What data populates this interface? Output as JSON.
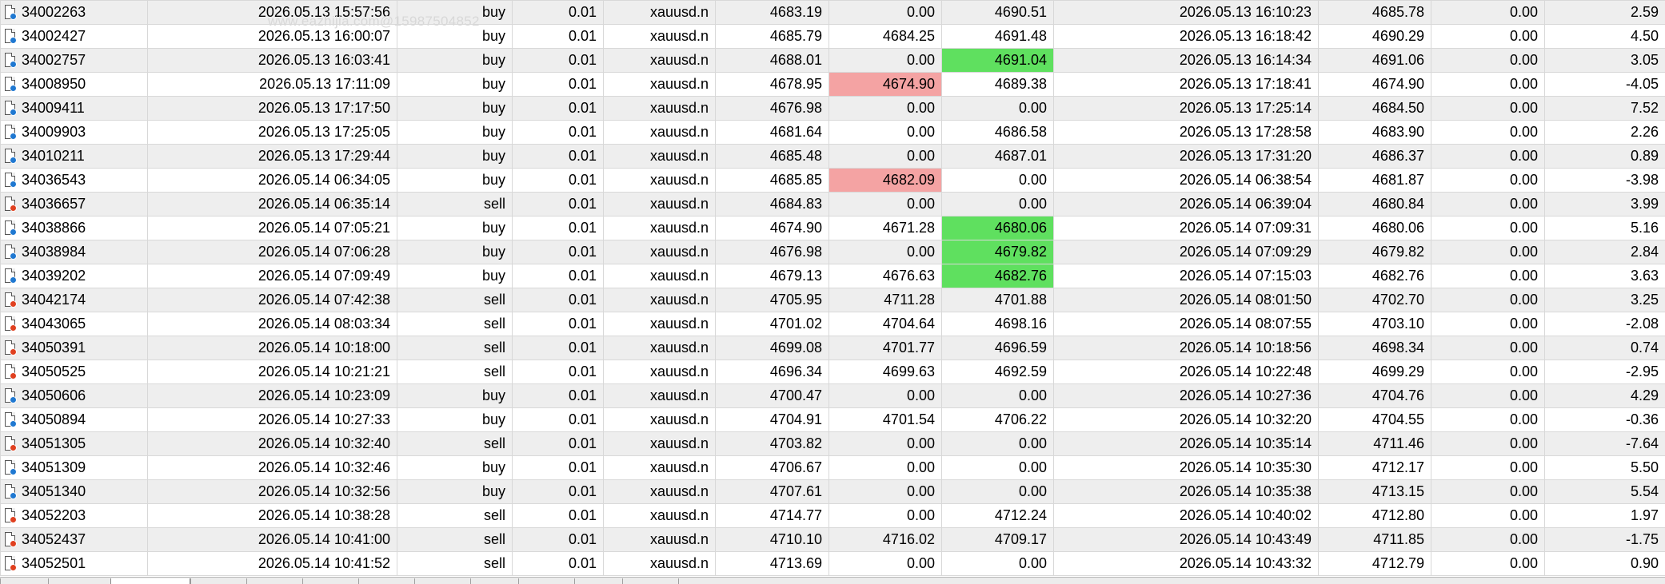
{
  "watermark": "www.eazhijia.com@15987504852",
  "colors": {
    "row_odd": "#eeeeee",
    "row_even": "#ffffff",
    "grid_line": "#d8d8d8",
    "stop_loss_hit": "#f4a3a3",
    "take_profit_hit": "#5fe05f",
    "buy_icon": "#1f78d1",
    "sell_icon": "#e0401f"
  },
  "rows": [
    {
      "ticket": "34002263",
      "open_time": "2026.05.13 15:57:56",
      "type": "buy",
      "volume": "0.01",
      "symbol": "xauusd.n",
      "open_price": "4683.19",
      "sl": "0.00",
      "tp": "4690.51",
      "close_time": "2026.05.13 16:10:23",
      "close_price": "4685.78",
      "swap": "0.00",
      "profit": "2.59",
      "icon": "buy-order-icon",
      "sl_hl": false,
      "tp_hl": false
    },
    {
      "ticket": "34002427",
      "open_time": "2026.05.13 16:00:07",
      "type": "buy",
      "volume": "0.01",
      "symbol": "xauusd.n",
      "open_price": "4685.79",
      "sl": "4684.25",
      "tp": "4691.48",
      "close_time": "2026.05.13 16:18:42",
      "close_price": "4690.29",
      "swap": "0.00",
      "profit": "4.50",
      "icon": "buy-order-icon",
      "sl_hl": false,
      "tp_hl": false
    },
    {
      "ticket": "34002757",
      "open_time": "2026.05.13 16:03:41",
      "type": "buy",
      "volume": "0.01",
      "symbol": "xauusd.n",
      "open_price": "4688.01",
      "sl": "0.00",
      "tp": "4691.04",
      "close_time": "2026.05.13 16:14:34",
      "close_price": "4691.06",
      "swap": "0.00",
      "profit": "3.05",
      "icon": "buy-order-icon",
      "sl_hl": false,
      "tp_hl": true
    },
    {
      "ticket": "34008950",
      "open_time": "2026.05.13 17:11:09",
      "type": "buy",
      "volume": "0.01",
      "symbol": "xauusd.n",
      "open_price": "4678.95",
      "sl": "4674.90",
      "tp": "4689.38",
      "close_time": "2026.05.13 17:18:41",
      "close_price": "4674.90",
      "swap": "0.00",
      "profit": "-4.05",
      "icon": "buy-order-icon",
      "sl_hl": true,
      "tp_hl": false
    },
    {
      "ticket": "34009411",
      "open_time": "2026.05.13 17:17:50",
      "type": "buy",
      "volume": "0.01",
      "symbol": "xauusd.n",
      "open_price": "4676.98",
      "sl": "0.00",
      "tp": "0.00",
      "close_time": "2026.05.13 17:25:14",
      "close_price": "4684.50",
      "swap": "0.00",
      "profit": "7.52",
      "icon": "buy-order-icon",
      "sl_hl": false,
      "tp_hl": false
    },
    {
      "ticket": "34009903",
      "open_time": "2026.05.13 17:25:05",
      "type": "buy",
      "volume": "0.01",
      "symbol": "xauusd.n",
      "open_price": "4681.64",
      "sl": "0.00",
      "tp": "4686.58",
      "close_time": "2026.05.13 17:28:58",
      "close_price": "4683.90",
      "swap": "0.00",
      "profit": "2.26",
      "icon": "buy-order-icon",
      "sl_hl": false,
      "tp_hl": false
    },
    {
      "ticket": "34010211",
      "open_time": "2026.05.13 17:29:44",
      "type": "buy",
      "volume": "0.01",
      "symbol": "xauusd.n",
      "open_price": "4685.48",
      "sl": "0.00",
      "tp": "4687.01",
      "close_time": "2026.05.13 17:31:20",
      "close_price": "4686.37",
      "swap": "0.00",
      "profit": "0.89",
      "icon": "buy-order-icon",
      "sl_hl": false,
      "tp_hl": false
    },
    {
      "ticket": "34036543",
      "open_time": "2026.05.14 06:34:05",
      "type": "buy",
      "volume": "0.01",
      "symbol": "xauusd.n",
      "open_price": "4685.85",
      "sl": "4682.09",
      "tp": "0.00",
      "close_time": "2026.05.14 06:38:54",
      "close_price": "4681.87",
      "swap": "0.00",
      "profit": "-3.98",
      "icon": "buy-order-icon",
      "sl_hl": true,
      "tp_hl": false
    },
    {
      "ticket": "34036657",
      "open_time": "2026.05.14 06:35:14",
      "type": "sell",
      "volume": "0.01",
      "symbol": "xauusd.n",
      "open_price": "4684.83",
      "sl": "0.00",
      "tp": "0.00",
      "close_time": "2026.05.14 06:39:04",
      "close_price": "4680.84",
      "swap": "0.00",
      "profit": "3.99",
      "icon": "sell-order-icon",
      "sl_hl": false,
      "tp_hl": false
    },
    {
      "ticket": "34038866",
      "open_time": "2026.05.14 07:05:21",
      "type": "buy",
      "volume": "0.01",
      "symbol": "xauusd.n",
      "open_price": "4674.90",
      "sl": "4671.28",
      "tp": "4680.06",
      "close_time": "2026.05.14 07:09:31",
      "close_price": "4680.06",
      "swap": "0.00",
      "profit": "5.16",
      "icon": "buy-order-icon",
      "sl_hl": false,
      "tp_hl": true
    },
    {
      "ticket": "34038984",
      "open_time": "2026.05.14 07:06:28",
      "type": "buy",
      "volume": "0.01",
      "symbol": "xauusd.n",
      "open_price": "4676.98",
      "sl": "0.00",
      "tp": "4679.82",
      "close_time": "2026.05.14 07:09:29",
      "close_price": "4679.82",
      "swap": "0.00",
      "profit": "2.84",
      "icon": "buy-order-icon",
      "sl_hl": false,
      "tp_hl": true
    },
    {
      "ticket": "34039202",
      "open_time": "2026.05.14 07:09:49",
      "type": "buy",
      "volume": "0.01",
      "symbol": "xauusd.n",
      "open_price": "4679.13",
      "sl": "4676.63",
      "tp": "4682.76",
      "close_time": "2026.05.14 07:15:03",
      "close_price": "4682.76",
      "swap": "0.00",
      "profit": "3.63",
      "icon": "buy-order-icon",
      "sl_hl": false,
      "tp_hl": true
    },
    {
      "ticket": "34042174",
      "open_time": "2026.05.14 07:42:38",
      "type": "sell",
      "volume": "0.01",
      "symbol": "xauusd.n",
      "open_price": "4705.95",
      "sl": "4711.28",
      "tp": "4701.88",
      "close_time": "2026.05.14 08:01:50",
      "close_price": "4702.70",
      "swap": "0.00",
      "profit": "3.25",
      "icon": "sell-order-icon",
      "sl_hl": false,
      "tp_hl": false
    },
    {
      "ticket": "34043065",
      "open_time": "2026.05.14 08:03:34",
      "type": "sell",
      "volume": "0.01",
      "symbol": "xauusd.n",
      "open_price": "4701.02",
      "sl": "4704.64",
      "tp": "4698.16",
      "close_time": "2026.05.14 08:07:55",
      "close_price": "4703.10",
      "swap": "0.00",
      "profit": "-2.08",
      "icon": "sell-order-icon",
      "sl_hl": false,
      "tp_hl": false
    },
    {
      "ticket": "34050391",
      "open_time": "2026.05.14 10:18:00",
      "type": "sell",
      "volume": "0.01",
      "symbol": "xauusd.n",
      "open_price": "4699.08",
      "sl": "4701.77",
      "tp": "4696.59",
      "close_time": "2026.05.14 10:18:56",
      "close_price": "4698.34",
      "swap": "0.00",
      "profit": "0.74",
      "icon": "sell-order-icon",
      "sl_hl": false,
      "tp_hl": false
    },
    {
      "ticket": "34050525",
      "open_time": "2026.05.14 10:21:21",
      "type": "sell",
      "volume": "0.01",
      "symbol": "xauusd.n",
      "open_price": "4696.34",
      "sl": "4699.63",
      "tp": "4692.59",
      "close_time": "2026.05.14 10:22:48",
      "close_price": "4699.29",
      "swap": "0.00",
      "profit": "-2.95",
      "icon": "sell-order-icon",
      "sl_hl": false,
      "tp_hl": false
    },
    {
      "ticket": "34050606",
      "open_time": "2026.05.14 10:23:09",
      "type": "buy",
      "volume": "0.01",
      "symbol": "xauusd.n",
      "open_price": "4700.47",
      "sl": "0.00",
      "tp": "0.00",
      "close_time": "2026.05.14 10:27:36",
      "close_price": "4704.76",
      "swap": "0.00",
      "profit": "4.29",
      "icon": "buy-order-icon",
      "sl_hl": false,
      "tp_hl": false
    },
    {
      "ticket": "34050894",
      "open_time": "2026.05.14 10:27:33",
      "type": "buy",
      "volume": "0.01",
      "symbol": "xauusd.n",
      "open_price": "4704.91",
      "sl": "4701.54",
      "tp": "4706.22",
      "close_time": "2026.05.14 10:32:20",
      "close_price": "4704.55",
      "swap": "0.00",
      "profit": "-0.36",
      "icon": "buy-order-icon",
      "sl_hl": false,
      "tp_hl": false
    },
    {
      "ticket": "34051305",
      "open_time": "2026.05.14 10:32:40",
      "type": "sell",
      "volume": "0.01",
      "symbol": "xauusd.n",
      "open_price": "4703.82",
      "sl": "0.00",
      "tp": "0.00",
      "close_time": "2026.05.14 10:35:14",
      "close_price": "4711.46",
      "swap": "0.00",
      "profit": "-7.64",
      "icon": "sell-order-icon",
      "sl_hl": false,
      "tp_hl": false
    },
    {
      "ticket": "34051309",
      "open_time": "2026.05.14 10:32:46",
      "type": "buy",
      "volume": "0.01",
      "symbol": "xauusd.n",
      "open_price": "4706.67",
      "sl": "0.00",
      "tp": "0.00",
      "close_time": "2026.05.14 10:35:30",
      "close_price": "4712.17",
      "swap": "0.00",
      "profit": "5.50",
      "icon": "buy-order-icon",
      "sl_hl": false,
      "tp_hl": false
    },
    {
      "ticket": "34051340",
      "open_time": "2026.05.14 10:32:56",
      "type": "buy",
      "volume": "0.01",
      "symbol": "xauusd.n",
      "open_price": "4707.61",
      "sl": "0.00",
      "tp": "0.00",
      "close_time": "2026.05.14 10:35:38",
      "close_price": "4713.15",
      "swap": "0.00",
      "profit": "5.54",
      "icon": "buy-order-icon",
      "sl_hl": false,
      "tp_hl": false
    },
    {
      "ticket": "34052203",
      "open_time": "2026.05.14 10:38:28",
      "type": "sell",
      "volume": "0.01",
      "symbol": "xauusd.n",
      "open_price": "4714.77",
      "sl": "0.00",
      "tp": "4712.24",
      "close_time": "2026.05.14 10:40:02",
      "close_price": "4712.80",
      "swap": "0.00",
      "profit": "1.97",
      "icon": "sell-order-icon",
      "sl_hl": false,
      "tp_hl": false
    },
    {
      "ticket": "34052437",
      "open_time": "2026.05.14 10:41:00",
      "type": "sell",
      "volume": "0.01",
      "symbol": "xauusd.n",
      "open_price": "4710.10",
      "sl": "4716.02",
      "tp": "4709.17",
      "close_time": "2026.05.14 10:43:49",
      "close_price": "4711.85",
      "swap": "0.00",
      "profit": "-1.75",
      "icon": "sell-order-icon",
      "sl_hl": false,
      "tp_hl": false
    },
    {
      "ticket": "34052501",
      "open_time": "2026.05.14 10:41:52",
      "type": "sell",
      "volume": "0.01",
      "symbol": "xauusd.n",
      "open_price": "4713.69",
      "sl": "0.00",
      "tp": "0.00",
      "close_time": "2026.05.14 10:43:32",
      "close_price": "4712.79",
      "swap": "0.00",
      "profit": "0.90",
      "icon": "sell-order-icon",
      "sl_hl": false,
      "tp_hl": false
    }
  ]
}
